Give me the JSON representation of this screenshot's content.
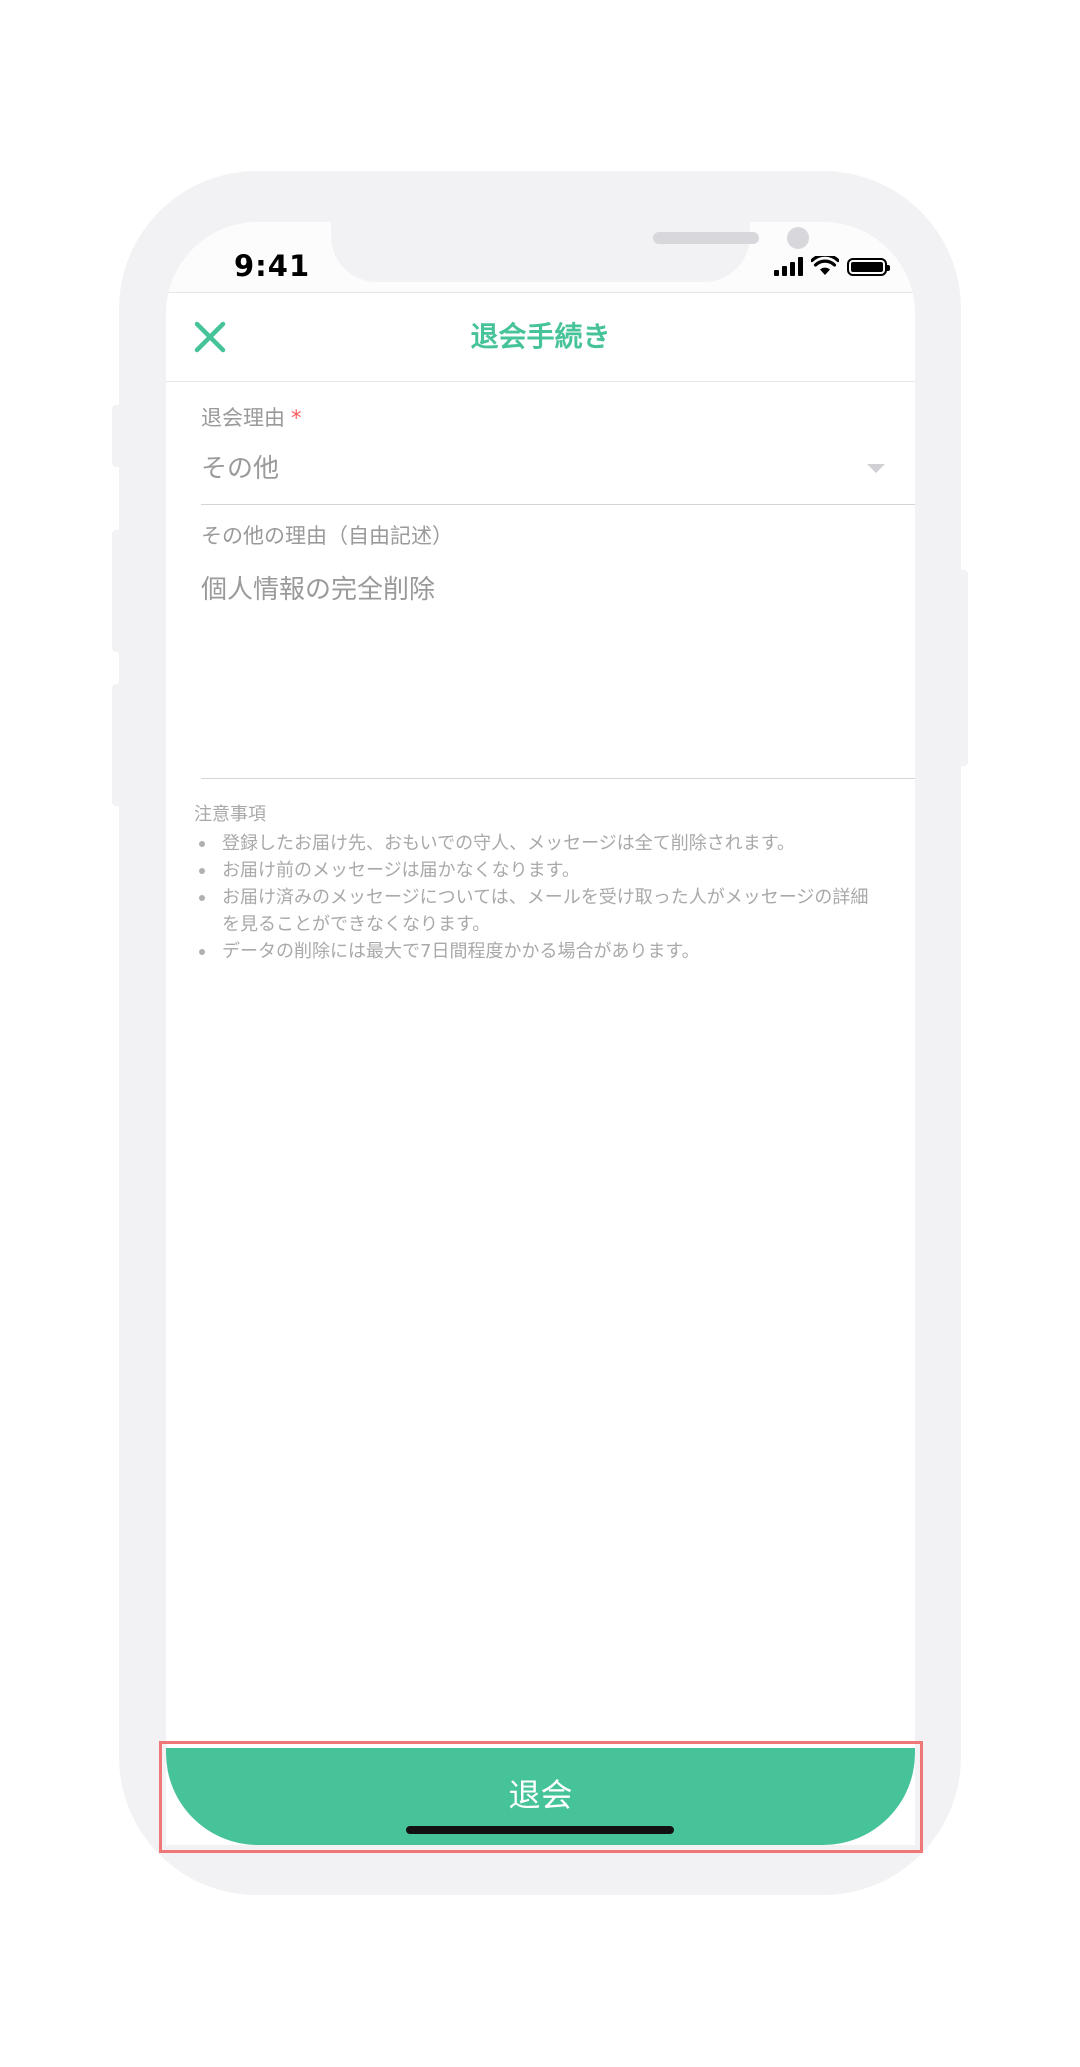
{
  "status_bar": {
    "time": "9:41",
    "icons": [
      "cellular-signal-icon",
      "wifi-icon",
      "battery-icon"
    ]
  },
  "header": {
    "title": "退会手続き",
    "close_icon": "close-icon"
  },
  "form": {
    "reason": {
      "label": "退会理由",
      "required_mark": "*",
      "value": "その他"
    },
    "other_reason": {
      "label": "その他の理由（自由記述）",
      "value": "個人情報の完全削除"
    }
  },
  "notes": {
    "title": "注意事項",
    "items": [
      "登録したお届け先、おもいでの守人、メッセージは全て削除されます。",
      "お届け前のメッセージは届かなくなります。",
      "お届け済みのメッセージについては、メールを受け取った人がメッセージの詳細を見ることができなくなります。",
      "データの削除には最大で7日間程度かかる場合があります。"
    ]
  },
  "footer": {
    "withdraw_label": "退会"
  },
  "colors": {
    "accent": "#47c39a",
    "required": "#ff5a5f",
    "highlight": "#f07777"
  }
}
